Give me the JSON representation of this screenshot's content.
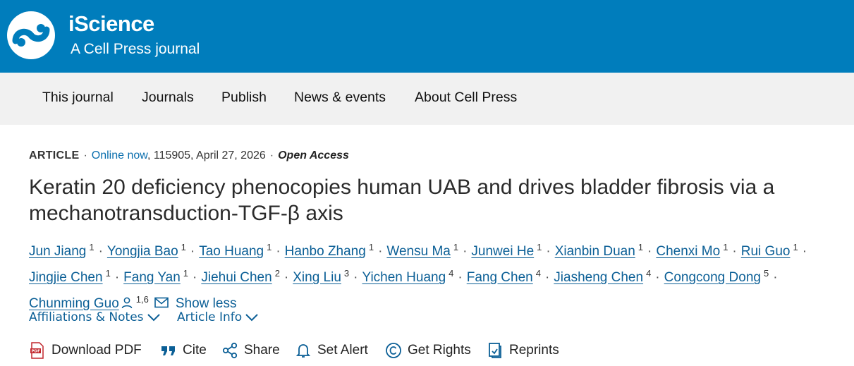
{
  "header": {
    "brand": "iScience",
    "tagline": "A Cell Press journal",
    "background_color": "#007dbc"
  },
  "nav": {
    "items": [
      {
        "label": "This journal"
      },
      {
        "label": "Journals"
      },
      {
        "label": "Publish"
      },
      {
        "label": "News & events"
      },
      {
        "label": "About Cell Press"
      }
    ]
  },
  "article": {
    "type": "ARTICLE",
    "status": "Online now",
    "details": ", 115905, April 27, 2026",
    "access": "Open Access",
    "title": "Keratin 20 deficiency phenocopies human UAB and drives bladder fibrosis via a mechanotransduction-TGF-β axis",
    "authors": [
      {
        "name": "Jun Jiang",
        "aff": "1"
      },
      {
        "name": "Yongjia Bao",
        "aff": "1"
      },
      {
        "name": "Tao Huang",
        "aff": "1"
      },
      {
        "name": "Hanbo Zhang",
        "aff": "1"
      },
      {
        "name": "Wensu Ma",
        "aff": "1"
      },
      {
        "name": "Junwei He",
        "aff": "1"
      },
      {
        "name": "Xianbin Duan",
        "aff": "1"
      },
      {
        "name": "Chenxi Mo",
        "aff": "1"
      },
      {
        "name": "Rui Guo",
        "aff": "1"
      },
      {
        "name": "Jingjie Chen",
        "aff": "1"
      },
      {
        "name": "Fang Yan",
        "aff": "1"
      },
      {
        "name": "Jiehui Chen",
        "aff": "2"
      },
      {
        "name": "Xing Liu",
        "aff": "3"
      },
      {
        "name": "Yichen Huang",
        "aff": "4"
      },
      {
        "name": "Fang Chen",
        "aff": "4"
      },
      {
        "name": "Jiasheng Chen",
        "aff": "4"
      },
      {
        "name": "Congcong Dong",
        "aff": "5"
      },
      {
        "name": "Chunming Guo",
        "aff": "1,6"
      }
    ],
    "show_less": "Show less",
    "affiliations_label": "Affiliations & Notes",
    "article_info_label": "Article Info"
  },
  "actions": [
    {
      "label": "Download PDF",
      "icon": "pdf-icon"
    },
    {
      "label": "Cite",
      "icon": "quote-icon"
    },
    {
      "label": "Share",
      "icon": "share-icon"
    },
    {
      "label": "Set Alert",
      "icon": "bell-icon"
    },
    {
      "label": "Get Rights",
      "icon": "copyright-icon"
    },
    {
      "label": "Reprints",
      "icon": "reprints-icon"
    }
  ],
  "colors": {
    "link": "#0b5f96",
    "nav_background": "#f1f1f1"
  }
}
